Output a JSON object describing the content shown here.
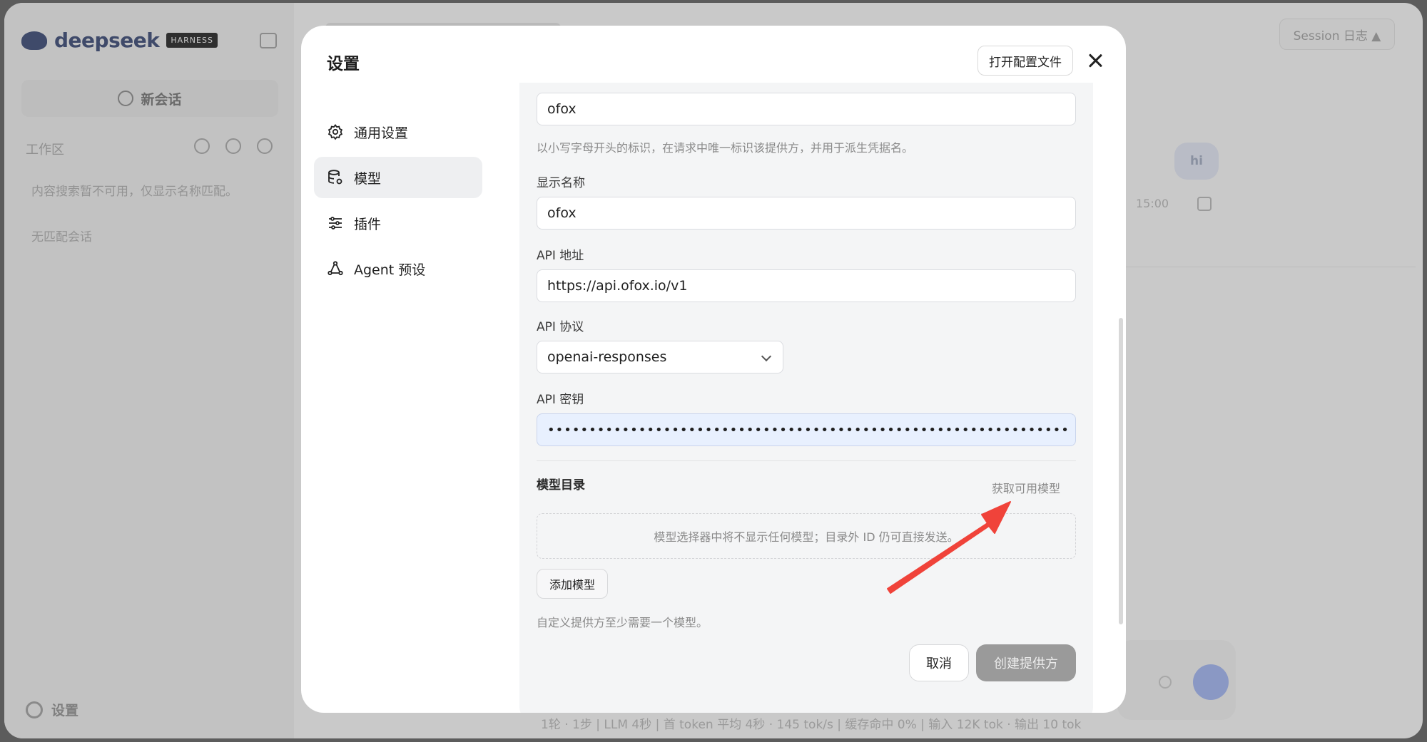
{
  "app": {
    "brand_name": "deepseek",
    "brand_badge": "HARNESS",
    "new_chat_label": "新会话",
    "workspace_label": "工作区",
    "search_note": "内容搜索暂不可用，仅显示名称匹配。",
    "no_match_note": "无匹配会话",
    "settings_label": "设置",
    "session_button": "Session 日志 ▲",
    "user_message": "hi",
    "message_time": "15:00",
    "status_line": "1轮 · 1步 | LLM 4秒 | 首 token 平均 4秒 · 145 tok/s | 缓存命中 0% | 输入 12K tok · 输出 10 tok"
  },
  "modal": {
    "title": "设置",
    "open_config_label": "打开配置文件",
    "nav": [
      {
        "label": "通用设置",
        "icon": "gear-icon"
      },
      {
        "label": "模型",
        "icon": "database-icon"
      },
      {
        "label": "插件",
        "icon": "sliders-icon"
      },
      {
        "label": "Agent 预设",
        "icon": "agent-icon"
      }
    ],
    "active_nav": "模型"
  },
  "form": {
    "provider_id_value": "ofox",
    "provider_id_hint": "以小写字母开头的标识，在请求中唯一标识该提供方，并用于派生凭据名。",
    "display_name_label": "显示名称",
    "display_name_value": "ofox",
    "api_url_label": "API 地址",
    "api_url_value": "https://api.ofox.io/v1",
    "api_protocol_label": "API 协议",
    "api_protocol_value": "openai-responses",
    "api_key_label": "API 密钥",
    "api_key_masked": "•••••••••••••••••••••••••••••••••••••••••••••••••••••••••••••••",
    "model_catalog_title": "模型目录",
    "fetch_models_label": "获取可用模型",
    "empty_catalog_text": "模型选择器中将不显示任何模型；目录外 ID 仍可直接发送。",
    "add_model_label": "添加模型",
    "min_model_hint": "自定义提供方至少需要一个模型。",
    "cancel_label": "取消",
    "create_label": "创建提供方"
  },
  "colors": {
    "overlay": "#5c5c5c",
    "modal_bg": "#ffffff",
    "panel_bg": "#f4f5f6",
    "create_disabled": "#9a9a9a",
    "annotation_arrow": "#f0433a"
  }
}
